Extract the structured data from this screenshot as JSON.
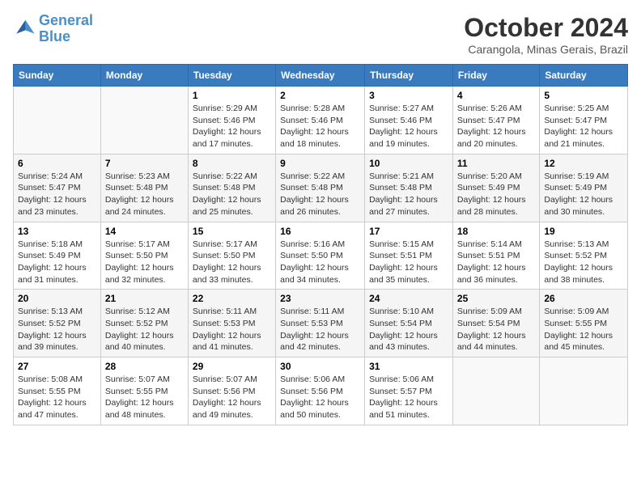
{
  "logo": {
    "line1": "General",
    "line2": "Blue"
  },
  "title": "October 2024",
  "subtitle": "Carangola, Minas Gerais, Brazil",
  "days_header": [
    "Sunday",
    "Monday",
    "Tuesday",
    "Wednesday",
    "Thursday",
    "Friday",
    "Saturday"
  ],
  "weeks": [
    [
      {
        "num": "",
        "info": ""
      },
      {
        "num": "",
        "info": ""
      },
      {
        "num": "1",
        "info": "Sunrise: 5:29 AM\nSunset: 5:46 PM\nDaylight: 12 hours and 17 minutes."
      },
      {
        "num": "2",
        "info": "Sunrise: 5:28 AM\nSunset: 5:46 PM\nDaylight: 12 hours and 18 minutes."
      },
      {
        "num": "3",
        "info": "Sunrise: 5:27 AM\nSunset: 5:46 PM\nDaylight: 12 hours and 19 minutes."
      },
      {
        "num": "4",
        "info": "Sunrise: 5:26 AM\nSunset: 5:47 PM\nDaylight: 12 hours and 20 minutes."
      },
      {
        "num": "5",
        "info": "Sunrise: 5:25 AM\nSunset: 5:47 PM\nDaylight: 12 hours and 21 minutes."
      }
    ],
    [
      {
        "num": "6",
        "info": "Sunrise: 5:24 AM\nSunset: 5:47 PM\nDaylight: 12 hours and 23 minutes."
      },
      {
        "num": "7",
        "info": "Sunrise: 5:23 AM\nSunset: 5:48 PM\nDaylight: 12 hours and 24 minutes."
      },
      {
        "num": "8",
        "info": "Sunrise: 5:22 AM\nSunset: 5:48 PM\nDaylight: 12 hours and 25 minutes."
      },
      {
        "num": "9",
        "info": "Sunrise: 5:22 AM\nSunset: 5:48 PM\nDaylight: 12 hours and 26 minutes."
      },
      {
        "num": "10",
        "info": "Sunrise: 5:21 AM\nSunset: 5:48 PM\nDaylight: 12 hours and 27 minutes."
      },
      {
        "num": "11",
        "info": "Sunrise: 5:20 AM\nSunset: 5:49 PM\nDaylight: 12 hours and 28 minutes."
      },
      {
        "num": "12",
        "info": "Sunrise: 5:19 AM\nSunset: 5:49 PM\nDaylight: 12 hours and 30 minutes."
      }
    ],
    [
      {
        "num": "13",
        "info": "Sunrise: 5:18 AM\nSunset: 5:49 PM\nDaylight: 12 hours and 31 minutes."
      },
      {
        "num": "14",
        "info": "Sunrise: 5:17 AM\nSunset: 5:50 PM\nDaylight: 12 hours and 32 minutes."
      },
      {
        "num": "15",
        "info": "Sunrise: 5:17 AM\nSunset: 5:50 PM\nDaylight: 12 hours and 33 minutes."
      },
      {
        "num": "16",
        "info": "Sunrise: 5:16 AM\nSunset: 5:50 PM\nDaylight: 12 hours and 34 minutes."
      },
      {
        "num": "17",
        "info": "Sunrise: 5:15 AM\nSunset: 5:51 PM\nDaylight: 12 hours and 35 minutes."
      },
      {
        "num": "18",
        "info": "Sunrise: 5:14 AM\nSunset: 5:51 PM\nDaylight: 12 hours and 36 minutes."
      },
      {
        "num": "19",
        "info": "Sunrise: 5:13 AM\nSunset: 5:52 PM\nDaylight: 12 hours and 38 minutes."
      }
    ],
    [
      {
        "num": "20",
        "info": "Sunrise: 5:13 AM\nSunset: 5:52 PM\nDaylight: 12 hours and 39 minutes."
      },
      {
        "num": "21",
        "info": "Sunrise: 5:12 AM\nSunset: 5:52 PM\nDaylight: 12 hours and 40 minutes."
      },
      {
        "num": "22",
        "info": "Sunrise: 5:11 AM\nSunset: 5:53 PM\nDaylight: 12 hours and 41 minutes."
      },
      {
        "num": "23",
        "info": "Sunrise: 5:11 AM\nSunset: 5:53 PM\nDaylight: 12 hours and 42 minutes."
      },
      {
        "num": "24",
        "info": "Sunrise: 5:10 AM\nSunset: 5:54 PM\nDaylight: 12 hours and 43 minutes."
      },
      {
        "num": "25",
        "info": "Sunrise: 5:09 AM\nSunset: 5:54 PM\nDaylight: 12 hours and 44 minutes."
      },
      {
        "num": "26",
        "info": "Sunrise: 5:09 AM\nSunset: 5:55 PM\nDaylight: 12 hours and 45 minutes."
      }
    ],
    [
      {
        "num": "27",
        "info": "Sunrise: 5:08 AM\nSunset: 5:55 PM\nDaylight: 12 hours and 47 minutes."
      },
      {
        "num": "28",
        "info": "Sunrise: 5:07 AM\nSunset: 5:55 PM\nDaylight: 12 hours and 48 minutes."
      },
      {
        "num": "29",
        "info": "Sunrise: 5:07 AM\nSunset: 5:56 PM\nDaylight: 12 hours and 49 minutes."
      },
      {
        "num": "30",
        "info": "Sunrise: 5:06 AM\nSunset: 5:56 PM\nDaylight: 12 hours and 50 minutes."
      },
      {
        "num": "31",
        "info": "Sunrise: 5:06 AM\nSunset: 5:57 PM\nDaylight: 12 hours and 51 minutes."
      },
      {
        "num": "",
        "info": ""
      },
      {
        "num": "",
        "info": ""
      }
    ]
  ]
}
